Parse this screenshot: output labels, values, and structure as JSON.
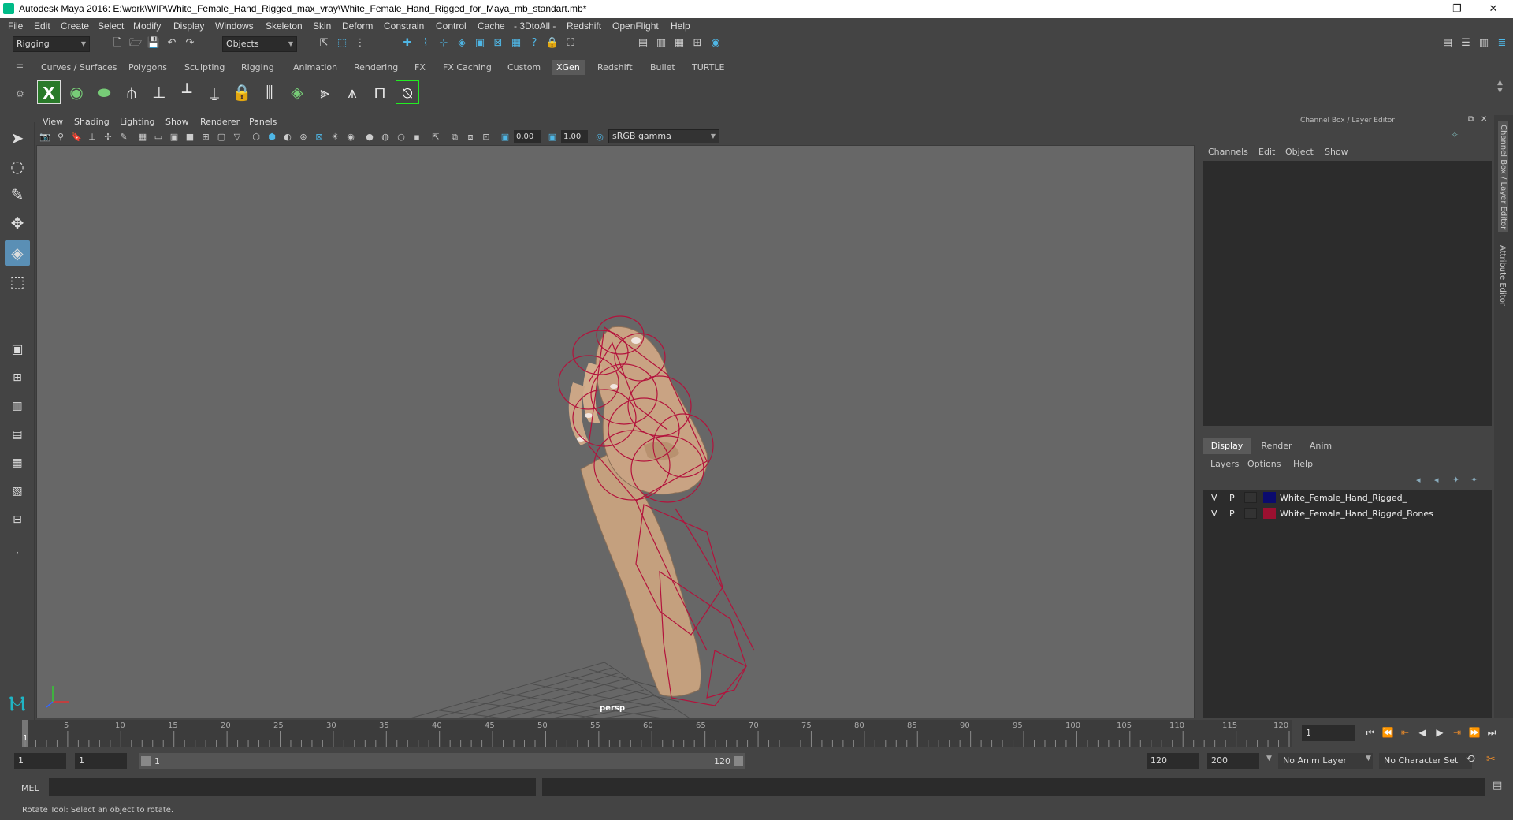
{
  "window": {
    "title": "Autodesk Maya 2016: E:\\work\\WIP\\White_Female_Hand_Rigged_max_vray\\White_Female_Hand_Rigged_for_Maya_mb_standart.mb*",
    "controls": [
      "—",
      "❐",
      "✕"
    ]
  },
  "menubar": {
    "items": [
      "File",
      "Edit",
      "Create",
      "Select",
      "Modify",
      "Display",
      "Windows",
      "Skeleton",
      "Skin",
      "Deform",
      "Constrain",
      "Control",
      "Cache",
      "- 3DtoAll -",
      "Redshift",
      "OpenFlight",
      "Help"
    ]
  },
  "statusline": {
    "menuset": "Rigging",
    "selection_mode": "Objects"
  },
  "shelf": {
    "tabs": [
      "Curves / Surfaces",
      "Polygons",
      "Sculpting",
      "Rigging",
      "Animation",
      "Rendering",
      "FX",
      "FX Caching",
      "Custom",
      "XGen",
      "Redshift",
      "Bullet",
      "TURTLE"
    ],
    "active_tab": "XGen"
  },
  "viewport": {
    "menu": [
      "View",
      "Shading",
      "Lighting",
      "Show",
      "Renderer",
      "Panels"
    ],
    "exposure": "0.00",
    "gamma": "1.00",
    "colorspace": "sRGB gamma",
    "camera_label": "persp"
  },
  "channelbox": {
    "title": "Channel Box / Layer Editor",
    "menu": [
      "Channels",
      "Edit",
      "Object",
      "Show"
    ]
  },
  "layereditor": {
    "tabs": [
      "Display",
      "Render",
      "Anim"
    ],
    "active_tab": "Display",
    "menu": [
      "Layers",
      "Options",
      "Help"
    ],
    "layers": [
      {
        "v": "V",
        "p": "P",
        "color": "#0b0b6e",
        "name": "White_Female_Hand_Rigged_"
      },
      {
        "v": "V",
        "p": "P",
        "color": "#9b1030",
        "name": "White_Female_Hand_Rigged_Bones"
      }
    ]
  },
  "sidetabs": {
    "channel": "Channel Box / Layer Editor",
    "attribute": "Attribute Editor"
  },
  "timeline": {
    "ticks": [
      "1",
      "5",
      "10",
      "15",
      "20",
      "25",
      "30",
      "35",
      "40",
      "45",
      "50",
      "55",
      "60",
      "65",
      "70",
      "75",
      "80",
      "85",
      "90",
      "95",
      "100",
      "105",
      "110",
      "115",
      "120"
    ],
    "current_frame": "1"
  },
  "range": {
    "start": "1",
    "playback_start": "1",
    "slider_start": "1",
    "slider_end": "120",
    "playback_end": "120",
    "end": "200",
    "anim_layer": "No Anim Layer",
    "character_set": "No Character Set"
  },
  "commandline": {
    "label": "MEL"
  },
  "helpline": {
    "text": "Rotate Tool: Select an object to rotate."
  }
}
